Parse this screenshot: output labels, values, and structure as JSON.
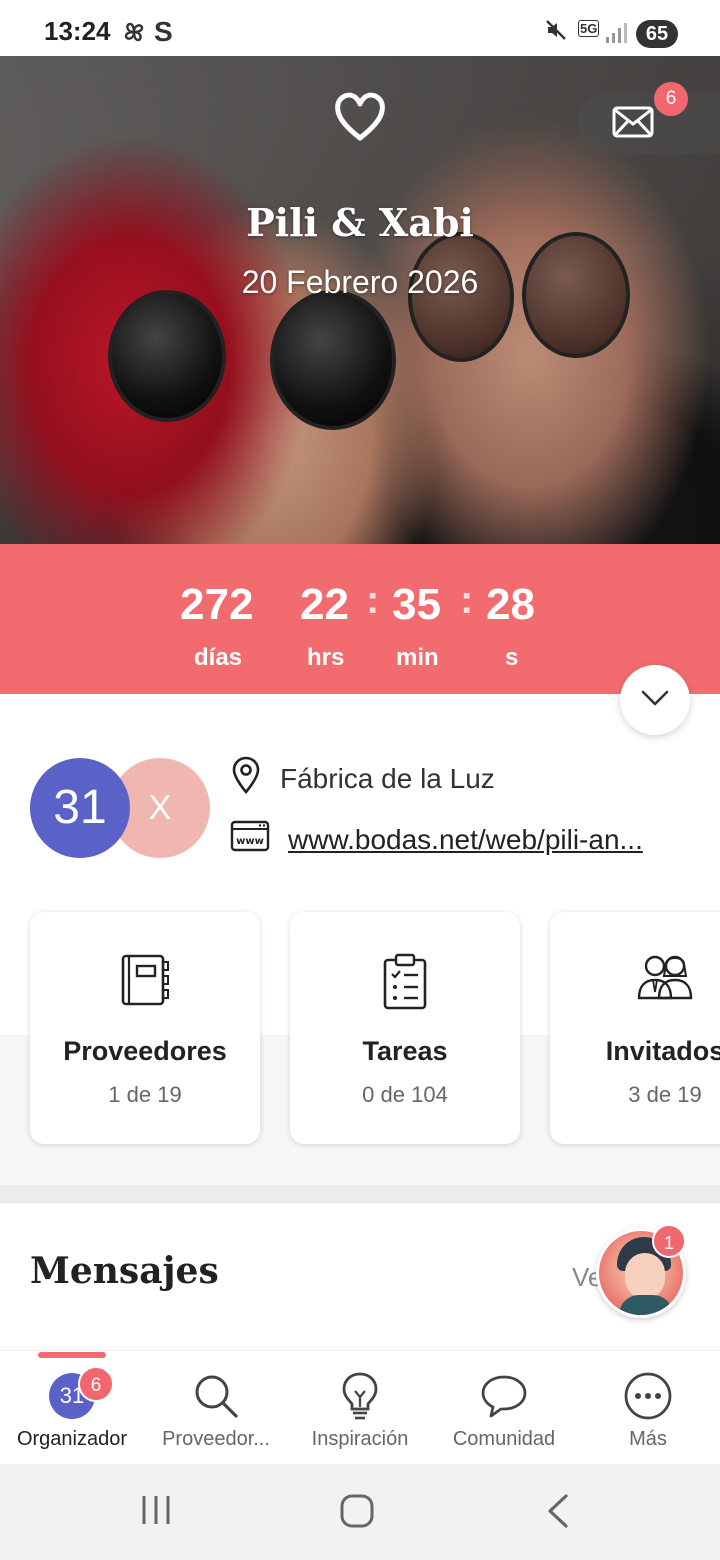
{
  "status_bar": {
    "time": "13:24",
    "app_indicator": "S",
    "network": "5G",
    "battery": "65"
  },
  "hero": {
    "names": "Pili & Xabi",
    "date": "20 Febrero 2026",
    "mail_badge": "6"
  },
  "countdown": {
    "days": "272",
    "hours": "22",
    "minutes": "35",
    "seconds": "28",
    "days_label": "días",
    "hours_label": "hrs",
    "minutes_label": "min",
    "seconds_label": "s",
    "separator": ":"
  },
  "info": {
    "calendar_day": "31",
    "partner_initial": "X",
    "venue": "Fábrica de la Luz",
    "website": "www.bodas.net/web/pili-an..."
  },
  "cards": [
    {
      "title": "Proveedores",
      "subtitle": "1 de 19",
      "icon": "notebook-icon"
    },
    {
      "title": "Tareas",
      "subtitle": "0 de 104",
      "icon": "clipboard-checklist-icon"
    },
    {
      "title": "Invitados",
      "subtitle": "3 de 19",
      "icon": "guests-icon"
    }
  ],
  "messages": {
    "title": "Mensajes",
    "see_all": "Ve",
    "avatar_badge": "1"
  },
  "bottom_nav": {
    "items": [
      {
        "label": "Organizador",
        "icon": "calendar-31-icon",
        "badge": "6",
        "day": "31"
      },
      {
        "label": "Proveedor...",
        "icon": "search-icon"
      },
      {
        "label": "Inspiración",
        "icon": "lightbulb-icon"
      },
      {
        "label": "Comunidad",
        "icon": "chat-bubble-icon"
      },
      {
        "label": "Más",
        "icon": "more-icon"
      }
    ]
  },
  "colors": {
    "accent": "#f26b6f",
    "calendar_blue": "#5a62c8",
    "partner_pink": "#f0b7b0",
    "badge": "#f0676f"
  }
}
